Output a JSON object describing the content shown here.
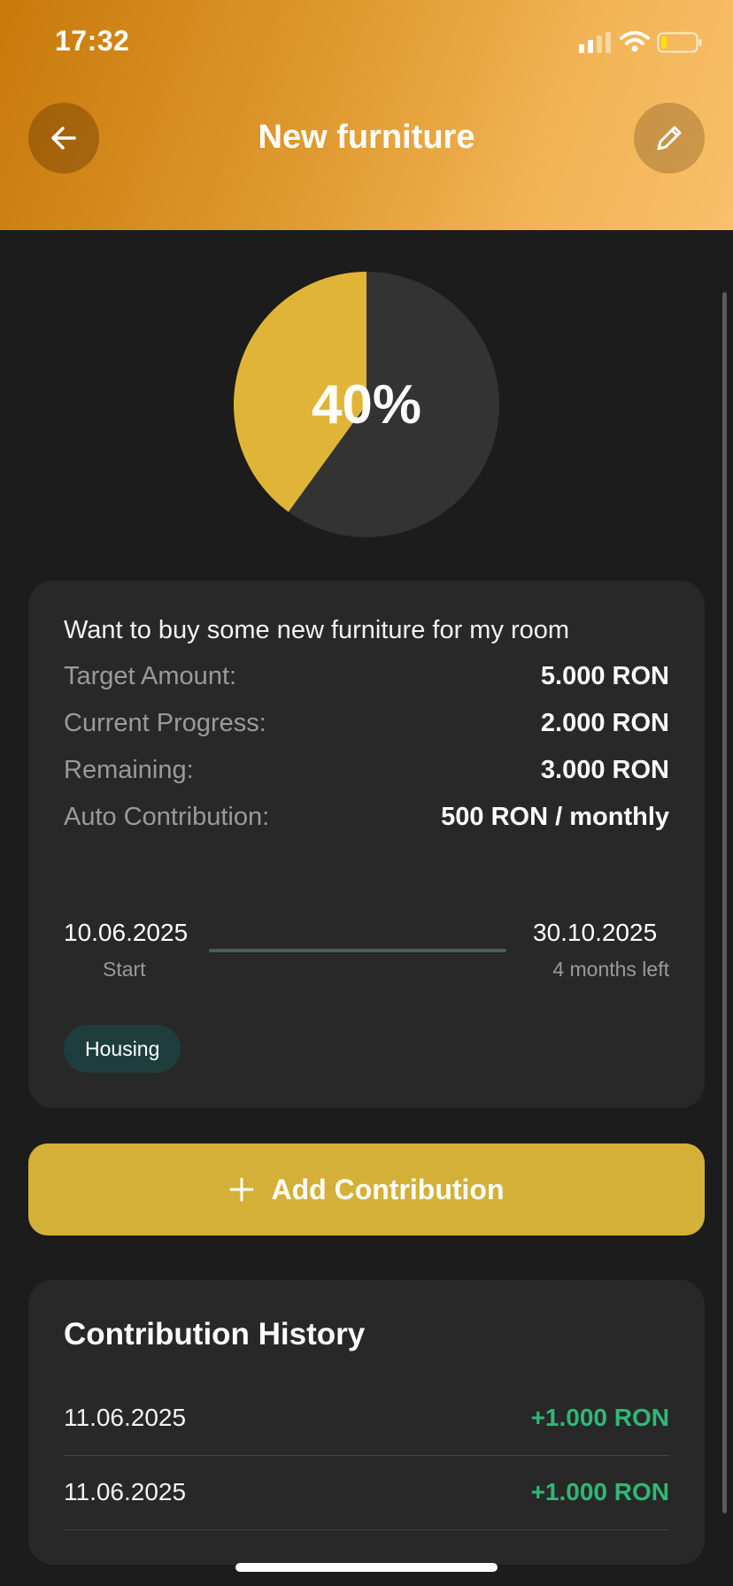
{
  "status_bar": {
    "time": "17:32",
    "icons": [
      "cellular-signal-icon",
      "wifi-icon",
      "battery-low-icon"
    ]
  },
  "header": {
    "title": "New furniture",
    "back_icon": "arrow-left-icon",
    "edit_icon": "pencil-icon"
  },
  "progress": {
    "percent": 40,
    "label": "40%",
    "fill_color": "#e0b537",
    "track_color": "#333333"
  },
  "goal": {
    "description": "Want to buy some new furniture for my room",
    "rows": [
      {
        "label": "Target Amount:",
        "value": "5.000 RON"
      },
      {
        "label": "Current Progress:",
        "value": "2.000 RON"
      },
      {
        "label": "Remaining:",
        "value": "3.000 RON"
      },
      {
        "label": "Auto Contribution:",
        "value": "500 RON / monthly"
      }
    ],
    "timeline": {
      "start_date": "10.06.2025",
      "start_label": "Start",
      "end_date": "30.10.2025",
      "end_label": "4 months left",
      "elapsed_fraction": 1.0
    },
    "category": "Housing"
  },
  "actions": {
    "add_contribution_label": "Add Contribution",
    "add_icon": "plus-icon"
  },
  "history": {
    "title": "Contribution History",
    "items": [
      {
        "date": "11.06.2025",
        "amount": "+1.000 RON"
      },
      {
        "date": "11.06.2025",
        "amount": "+1.000 RON"
      }
    ]
  },
  "colors": {
    "accent": "#d4b038",
    "positive": "#2fb877",
    "background": "#1c1c1c",
    "card": "#282828",
    "header_gradient": [
      "#c8790a",
      "#f8c06a"
    ]
  }
}
